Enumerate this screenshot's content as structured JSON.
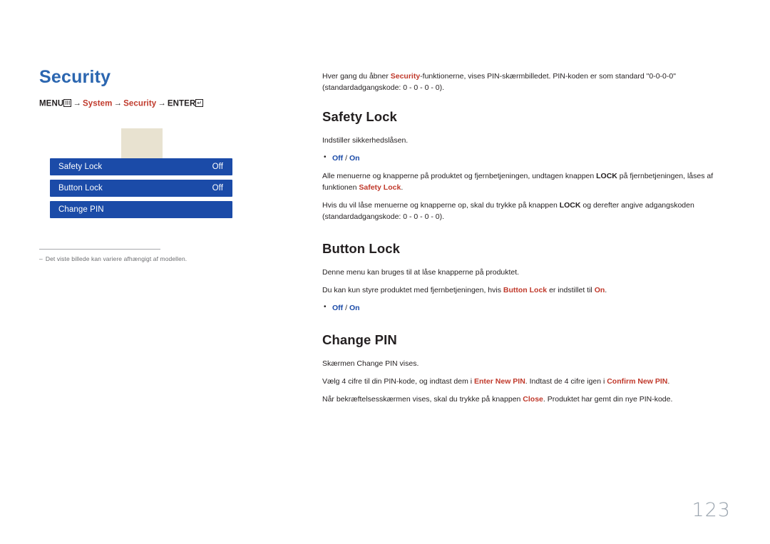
{
  "left": {
    "title": "Security",
    "menu_path": {
      "menu_label": "MENU",
      "menu_glyph": "III",
      "arrow": "→",
      "step1": "System",
      "step2": "Security",
      "enter_label": "ENTER",
      "enter_glyph": "↵"
    },
    "osd": {
      "rows": [
        {
          "label": "Safety Lock",
          "value": "Off"
        },
        {
          "label": "Button Lock",
          "value": "Off"
        },
        {
          "label": "Change PIN",
          "value": ""
        }
      ]
    },
    "footnote": {
      "dash": "‒",
      "text": "Det viste billede kan variere afhængigt af modellen."
    }
  },
  "right": {
    "intro": {
      "p1a": "Hver gang du åbner ",
      "p1b": "Security",
      "p1c": "-funktionerne, vises PIN-skærmbilledet. PIN-koden er som standard \"0-0-0-0\" (standardadgangskode: 0 - 0 - 0 - 0)."
    },
    "sections": [
      {
        "heading": "Safety Lock",
        "p1": "Indstiller sikkerhedslåsen.",
        "options": {
          "off": "Off",
          "sep": " / ",
          "on": "On"
        },
        "p2a": "Alle menuerne og knapperne på produktet og fjernbetjeningen, undtagen knappen ",
        "p2b": "LOCK",
        "p2c": " på fjernbetjeningen, låses af funktionen ",
        "p2d": "Safety Lock",
        "p2e": ".",
        "p3a": "Hvis du vil låse menuerne og knapperne op, skal du trykke på knappen ",
        "p3b": "LOCK",
        "p3c": " og derefter angive adgangskoden (standardadgangskode: 0 - 0 - 0 - 0)."
      },
      {
        "heading": "Button Lock",
        "p1": "Denne menu kan bruges til at låse knapperne på produktet.",
        "p2a": "Du kan kun styre produktet med fjernbetjeningen, hvis ",
        "p2b": "Button Lock",
        "p2c": " er indstillet til ",
        "p2d": "On",
        "p2e": ".",
        "options": {
          "off": "Off",
          "sep": " / ",
          "on": "On"
        }
      },
      {
        "heading": "Change PIN",
        "p1": "Skærmen Change PIN vises.",
        "p2a": "Vælg 4 cifre til din PIN-kode, og indtast dem i ",
        "p2b": "Enter New PIN",
        "p2c": ". Indtast de 4 cifre igen i ",
        "p2d": "Confirm New PIN",
        "p2e": ".",
        "p3a": "Når bekræftelsesskærmen vises, skal du trykke på knappen ",
        "p3b": "Close",
        "p3c": ". Produktet har gemt din nye PIN-kode."
      }
    ]
  },
  "page_number": "123"
}
